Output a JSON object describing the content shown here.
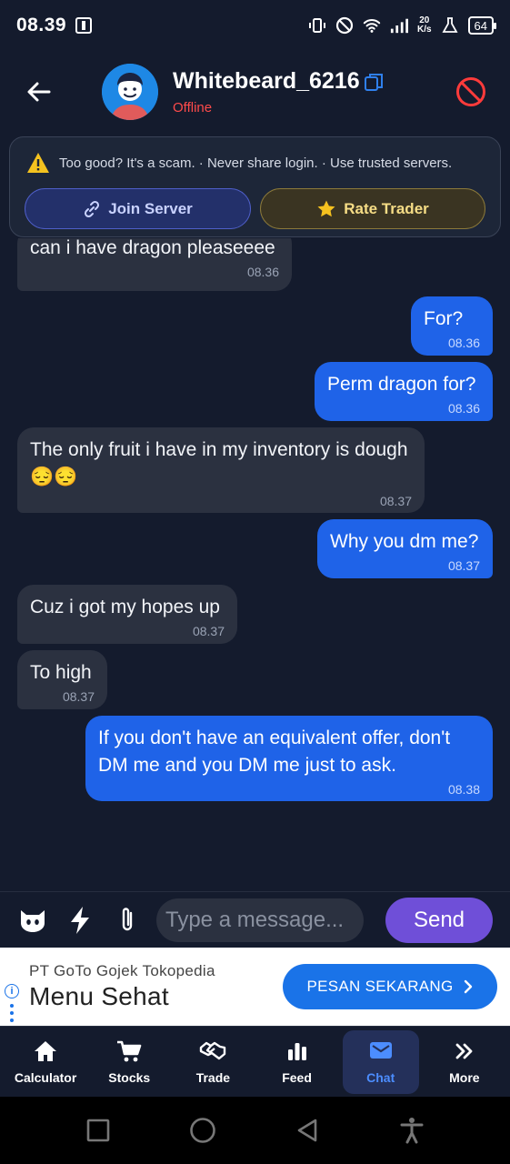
{
  "status_bar": {
    "time": "08.39",
    "speed_value": "20",
    "speed_unit": "K/s",
    "battery": "64"
  },
  "header": {
    "username": "Whitebeard_6216",
    "status": "Offline",
    "status_color": "#ff4b4b"
  },
  "warning": {
    "text": "Too good? It's a scam. · Never share login. · Use trusted servers.",
    "join_label": "Join Server",
    "rate_label": "Rate Trader"
  },
  "messages": [
    {
      "dir": "in",
      "text": "can i have dragon pleaseeee",
      "time": "08.36"
    },
    {
      "dir": "out",
      "text": "For?",
      "time": "08.36"
    },
    {
      "dir": "out",
      "text": "Perm dragon for?",
      "time": "08.36"
    },
    {
      "dir": "in",
      "text": "The only fruit i have in my inventory is dough😔😔",
      "time": "08.37"
    },
    {
      "dir": "out",
      "text": "Why you dm me?",
      "time": "08.37"
    },
    {
      "dir": "in",
      "text": "Cuz i got my hopes up",
      "time": "08.37"
    },
    {
      "dir": "in",
      "text": "To high",
      "time": "08.37"
    },
    {
      "dir": "out",
      "text": "If you don't have an equivalent offer, don't DM me and you DM me just to ask.",
      "time": "08.38"
    }
  ],
  "composer": {
    "placeholder": "Type a message...",
    "send_label": "Send"
  },
  "ad": {
    "company": "PT GoTo Gojek Tokopedia",
    "title": "Menu Sehat",
    "cta": "PESAN SEKARANG"
  },
  "nav": [
    {
      "label": "Calculator",
      "icon": "home-icon"
    },
    {
      "label": "Stocks",
      "icon": "cart-icon"
    },
    {
      "label": "Trade",
      "icon": "handshake-icon"
    },
    {
      "label": "Feed",
      "icon": "bar-chart-icon"
    },
    {
      "label": "Chat",
      "icon": "chat-icon",
      "active": true
    },
    {
      "label": "More",
      "icon": "double-chevron-icon"
    }
  ],
  "colors": {
    "background": "#141b2d",
    "incoming_bubble": "#2b3140",
    "outgoing_bubble": "#1f63e8",
    "send_button": "#6f4fd8",
    "active_nav": "#4c8dff"
  }
}
